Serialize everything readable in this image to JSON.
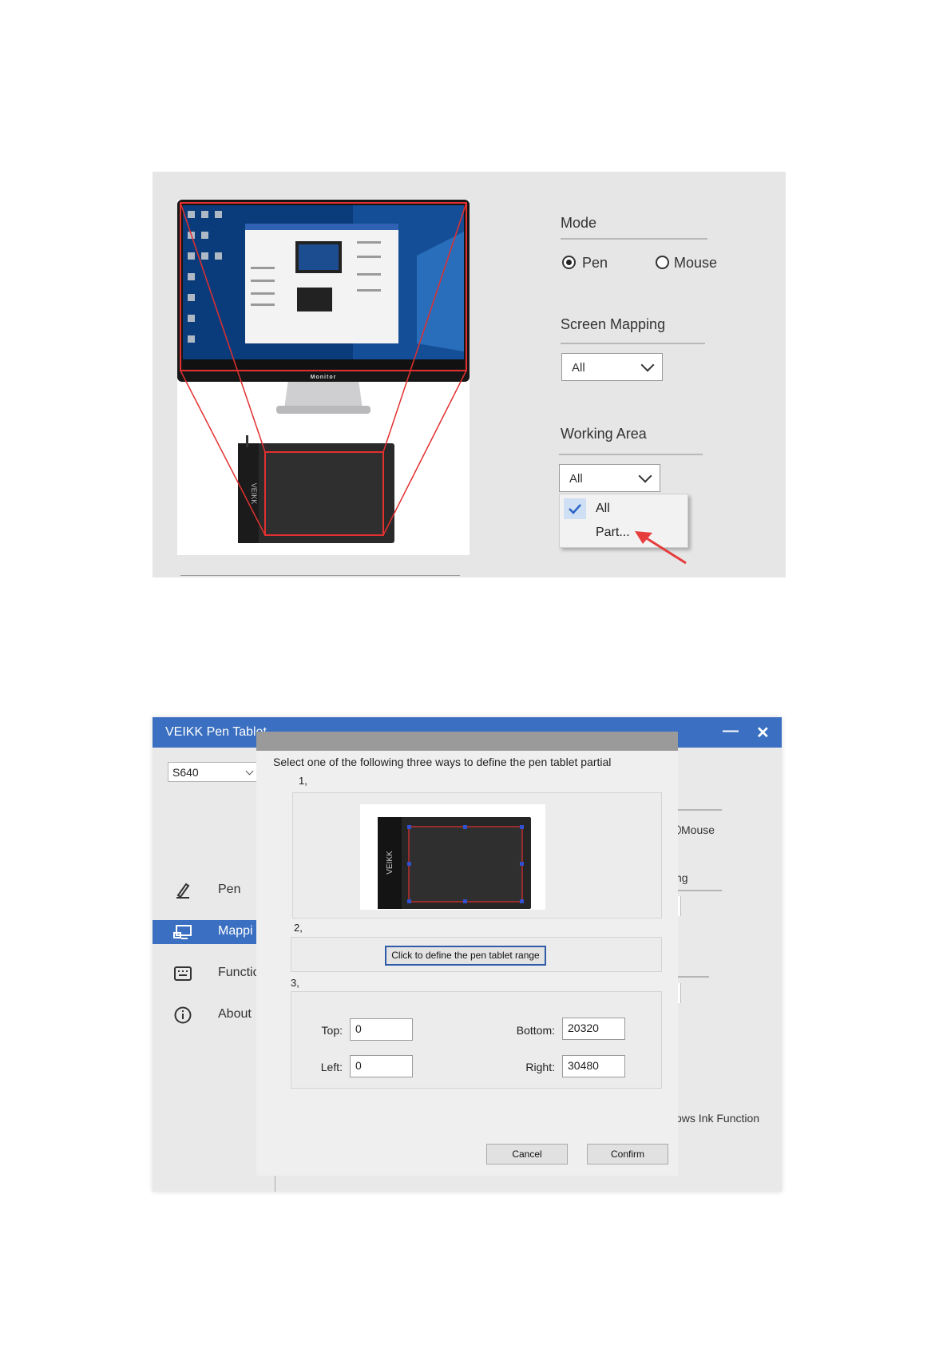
{
  "screenshot1": {
    "monitor_label": "Monitor",
    "tablet_brand": "VEIKK",
    "mode": {
      "title": "Mode",
      "options": [
        {
          "label": "Pen",
          "checked": true
        },
        {
          "label": "Mouse",
          "checked": false
        }
      ]
    },
    "screen_mapping": {
      "title": "Screen Mapping",
      "value": "All"
    },
    "working_area": {
      "title": "Working Area",
      "value": "All",
      "menu": [
        {
          "label": "All",
          "checked": true
        },
        {
          "label": "Part...",
          "checked": false
        }
      ]
    },
    "colors": {
      "highlight": "#e23030",
      "pointer_arrow": "#e63c3c",
      "check": "#2c64c6"
    }
  },
  "screenshot2": {
    "window_title": "VEIKK Pen Tablet",
    "window_buttons": {
      "minimize": "—",
      "close": "✕"
    },
    "device_select": "S640",
    "nav": [
      {
        "label": "Pen",
        "icon": "pen-icon",
        "active": false
      },
      {
        "label": "Mappi",
        "icon": "mapping-icon",
        "active": true
      },
      {
        "label": "Functic",
        "icon": "keyboard-icon",
        "active": false
      },
      {
        "label": "About",
        "icon": "info-icon",
        "active": false
      }
    ],
    "background_fragments": {
      "mouse": "Mouse",
      "mapping_tail": "ng",
      "ink": "ows Ink Function"
    },
    "dialog": {
      "instruction": "Select one of the following three ways to define the pen tablet partial",
      "step1": "1,",
      "step2": "2,",
      "step3": "3,",
      "tablet_brand": "VEIKK",
      "define_button": "Click to define the pen tablet range",
      "fields": {
        "top": {
          "label": "Top:",
          "value": "0"
        },
        "bottom": {
          "label": "Bottom:",
          "value": "20320"
        },
        "left": {
          "label": "Left:",
          "value": "0"
        },
        "right": {
          "label": "Right:",
          "value": "30480"
        }
      },
      "cancel": "Cancel",
      "confirm": "Confirm"
    },
    "colors": {
      "titlebar": "#3a6fc1",
      "focus_border": "#2f5ba8"
    }
  }
}
